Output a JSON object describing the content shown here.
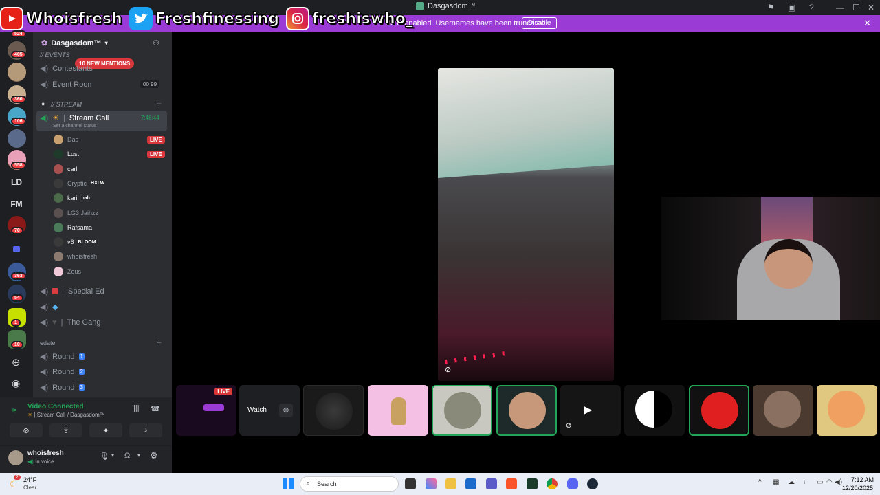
{
  "titlebar": {
    "title": "Dasgasdom™"
  },
  "banner": {
    "message": "de is enabled. Usernames have been truncated.",
    "button": "Disable"
  },
  "overlay": {
    "youtube": "Whoisfresh",
    "twitter": "Freshfinessing",
    "instagram": "freshiswho_"
  },
  "servers": {
    "badges": [
      "524",
      "405",
      "360",
      "106",
      "558",
      "70",
      "363",
      "54",
      "1",
      "10"
    ],
    "text_items": [
      "LD",
      "FM"
    ]
  },
  "guild": {
    "name": "Dasgasdom™",
    "mentions": "10 NEW MENTIONS",
    "categories": {
      "events": "// Events",
      "stream": "// STREAM",
      "edate": "edate"
    },
    "channels": {
      "contestants": "Contestants",
      "event_room": "Event Room",
      "event_room_counts": [
        "00",
        "99"
      ],
      "stream_call": "Stream Call",
      "stream_call_timer": "7:48:44",
      "stream_call_status": "Set a channel status",
      "special_ed": "Special Ed",
      "the_gang": "The Gang",
      "rounds": [
        "Round",
        "Round",
        "Round"
      ],
      "round_numbers": [
        "1",
        "2",
        "3"
      ]
    },
    "users": [
      {
        "name": "Das",
        "live": "LIVE"
      },
      {
        "name": "Lost",
        "live": "LIVE"
      },
      {
        "name": "carl"
      },
      {
        "name": "Cryptic",
        "tag": "HXLW"
      },
      {
        "name": "kari",
        "tag": "nah"
      },
      {
        "name": "LG3 Jaihzz"
      },
      {
        "name": "Rafsama"
      },
      {
        "name": "v6",
        "tag": "BLOOM"
      },
      {
        "name": "whoisfresh"
      },
      {
        "name": "Zeus"
      }
    ]
  },
  "voice": {
    "status": "Video Connected",
    "location": "Stream Call / Dasgasdom™"
  },
  "user_panel": {
    "username": "whoisfresh",
    "status": "In voice"
  },
  "tiles": {
    "live": "LIVE",
    "watch": "Watch"
  },
  "taskbar": {
    "weather": "24°F",
    "weather_desc": "Clear",
    "weather_badge": "2",
    "search": "Search",
    "time": "7:12 AM",
    "date": "12/20/2025"
  },
  "colors": {
    "accent": "#9b3bd6",
    "live": "#da373c",
    "green": "#23a559"
  }
}
